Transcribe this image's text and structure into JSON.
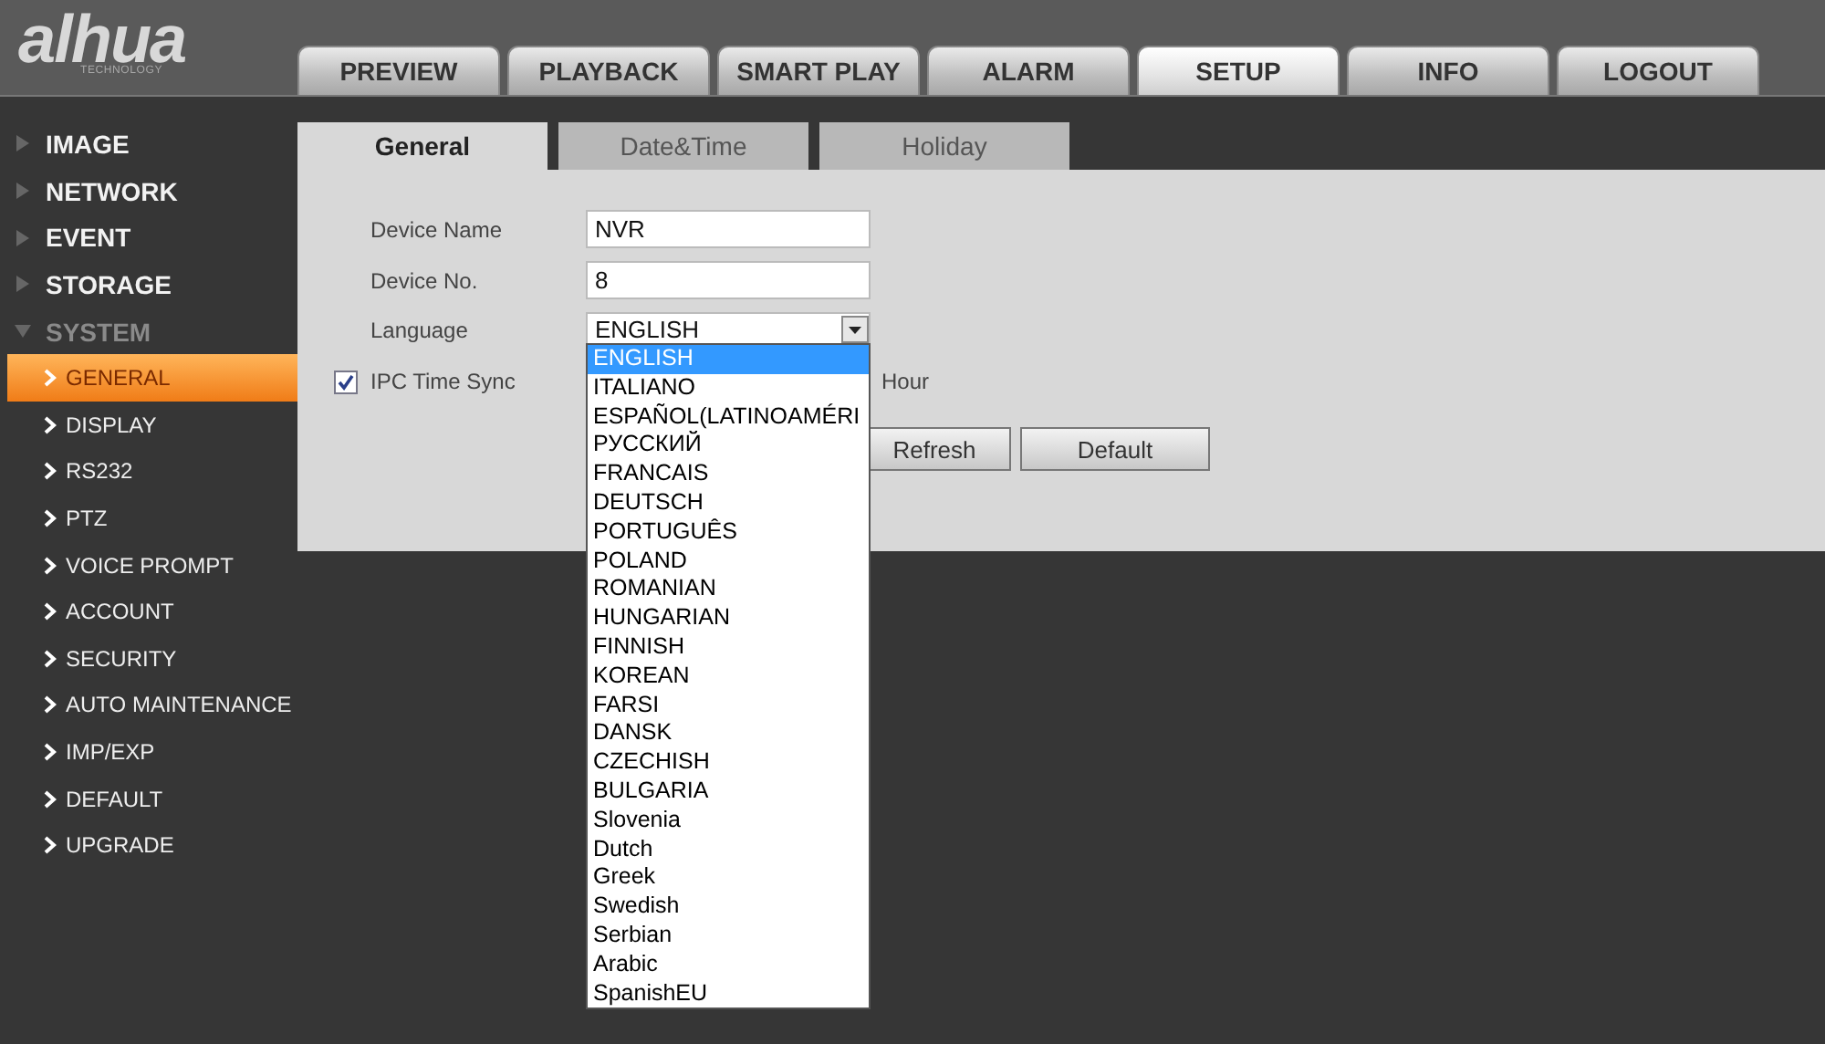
{
  "logo": {
    "wordmark": "alhua",
    "tagline": "TECHNOLOGY"
  },
  "main_tabs": [
    {
      "label": "PREVIEW",
      "selected": false
    },
    {
      "label": "PLAYBACK",
      "selected": false
    },
    {
      "label": "SMART PLAY",
      "selected": false
    },
    {
      "label": "ALARM",
      "selected": false
    },
    {
      "label": "SETUP",
      "selected": true
    },
    {
      "label": "INFO",
      "selected": false
    },
    {
      "label": "LOGOUT",
      "selected": false
    }
  ],
  "sidebar": {
    "items": [
      {
        "label": "IMAGE",
        "expanded": false
      },
      {
        "label": "NETWORK",
        "expanded": false
      },
      {
        "label": "EVENT",
        "expanded": false
      },
      {
        "label": "STORAGE",
        "expanded": false
      },
      {
        "label": "SYSTEM",
        "expanded": true,
        "children": [
          {
            "label": "GENERAL",
            "selected": true
          },
          {
            "label": "DISPLAY",
            "selected": false
          },
          {
            "label": "RS232",
            "selected": false
          },
          {
            "label": "PTZ",
            "selected": false
          },
          {
            "label": "VOICE PROMPT",
            "selected": false
          },
          {
            "label": "ACCOUNT",
            "selected": false
          },
          {
            "label": "SECURITY",
            "selected": false
          },
          {
            "label": "AUTO MAINTENANCE",
            "selected": false
          },
          {
            "label": "IMP/EXP",
            "selected": false
          },
          {
            "label": "DEFAULT",
            "selected": false
          },
          {
            "label": "UPGRADE",
            "selected": false
          }
        ]
      }
    ]
  },
  "sub_tabs": [
    {
      "label": "General",
      "selected": true
    },
    {
      "label": "Date&Time",
      "selected": false
    },
    {
      "label": "Holiday",
      "selected": false
    }
  ],
  "form": {
    "device_name": {
      "label": "Device Name",
      "value": "NVR"
    },
    "device_no": {
      "label": "Device No.",
      "value": "8"
    },
    "language": {
      "label": "Language",
      "value": "ENGLISH",
      "expanded": true,
      "options": [
        {
          "label": "ENGLISH",
          "selected": true
        },
        {
          "label": "ITALIANO",
          "selected": false
        },
        {
          "label": "ESPAÑOL(LATINOAMÉRI",
          "selected": false
        },
        {
          "label": "РУССКИЙ",
          "selected": false
        },
        {
          "label": "FRANCAIS",
          "selected": false
        },
        {
          "label": "DEUTSCH",
          "selected": false
        },
        {
          "label": "PORTUGUÊS",
          "selected": false
        },
        {
          "label": "POLAND",
          "selected": false
        },
        {
          "label": "ROMANIAN",
          "selected": false
        },
        {
          "label": "HUNGARIAN",
          "selected": false
        },
        {
          "label": "FINNISH",
          "selected": false
        },
        {
          "label": "KOREAN",
          "selected": false
        },
        {
          "label": "FARSI",
          "selected": false
        },
        {
          "label": "DANSK",
          "selected": false
        },
        {
          "label": "CZECHISH",
          "selected": false
        },
        {
          "label": "BULGARIA",
          "selected": false
        },
        {
          "label": "Slovenia",
          "selected": false
        },
        {
          "label": "Dutch",
          "selected": false
        },
        {
          "label": "Greek",
          "selected": false
        },
        {
          "label": "Swedish",
          "selected": false
        },
        {
          "label": "Serbian",
          "selected": false
        },
        {
          "label": "Arabic",
          "selected": false
        },
        {
          "label": "SpanishEU",
          "selected": false
        }
      ]
    },
    "ipc_time_sync": {
      "label": "IPC Time Sync",
      "checked": true,
      "unit": "Hour"
    },
    "buttons": [
      "Refresh",
      "Default"
    ]
  }
}
